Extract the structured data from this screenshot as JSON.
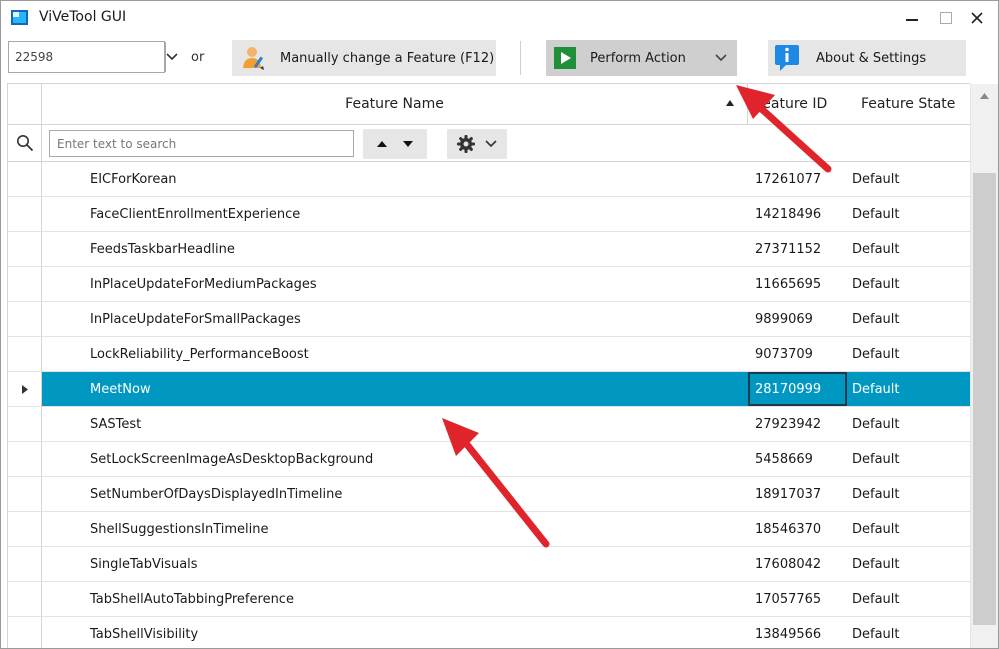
{
  "window": {
    "title": "ViVeTool GUI"
  },
  "toolbar": {
    "build_value": "22598",
    "or_label": "or",
    "manual_label": "Manually change a Feature (F12)",
    "perform_label": "Perform Action",
    "about_label": "About & Settings"
  },
  "grid": {
    "columns": {
      "name": "Feature Name",
      "id": "Feature ID",
      "state": "Feature State"
    },
    "search_placeholder": "Enter text to search",
    "rows": [
      {
        "name": "EICForKorean",
        "id": "17261077",
        "state": "Default"
      },
      {
        "name": "FaceClientEnrollmentExperience",
        "id": "14218496",
        "state": "Default"
      },
      {
        "name": "FeedsTaskbarHeadline",
        "id": "27371152",
        "state": "Default"
      },
      {
        "name": "InPlaceUpdateForMediumPackages",
        "id": "11665695",
        "state": "Default"
      },
      {
        "name": "InPlaceUpdateForSmallPackages",
        "id": "9899069",
        "state": "Default"
      },
      {
        "name": "LockReliability_PerformanceBoost",
        "id": "9073709",
        "state": "Default"
      },
      {
        "name": "MeetNow",
        "id": "28170999",
        "state": "Default"
      },
      {
        "name": "SASTest",
        "id": "27923942",
        "state": "Default"
      },
      {
        "name": "SetLockScreenImageAsDesktopBackground",
        "id": "5458669",
        "state": "Default"
      },
      {
        "name": "SetNumberOfDaysDisplayedInTimeline",
        "id": "18917037",
        "state": "Default"
      },
      {
        "name": "ShellSuggestionsInTimeline",
        "id": "18546370",
        "state": "Default"
      },
      {
        "name": "SingleTabVisuals",
        "id": "17608042",
        "state": "Default"
      },
      {
        "name": "TabShellAutoTabbingPreference",
        "id": "17057765",
        "state": "Default"
      },
      {
        "name": "TabShellVisibility",
        "id": "13849566",
        "state": "Default"
      }
    ]
  },
  "icons": {
    "app": "vivetool-app-icon",
    "manual": "user-edit-icon",
    "perform": "play-icon",
    "about": "info-icon",
    "search": "search-icon",
    "settings": "gear-icon"
  },
  "colors": {
    "selection": "#0098c0",
    "annotation": "#e0242b",
    "play_green": "#1f8f3a",
    "info_blue": "#1e88e5"
  }
}
